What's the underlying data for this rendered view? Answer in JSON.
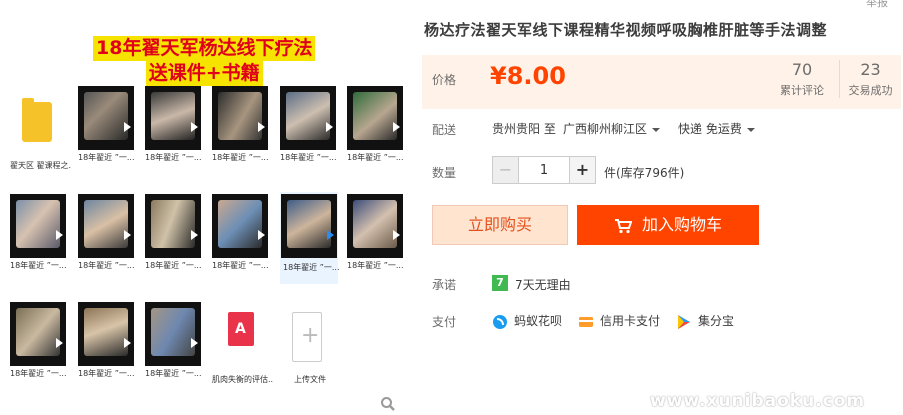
{
  "gallery": {
    "banner": {
      "line1": "18年翟天军杨达线下疗法",
      "line2": "送课件+书籍"
    },
    "items": [
      {
        "caption": "翟天区 翟课程之..."
      },
      {
        "caption": "18年翟近 ”一..."
      },
      {
        "caption": "18年翟近 ”一..."
      },
      {
        "caption": "18年翟近 ”一..."
      },
      {
        "caption": "18年翟近 ”一..."
      },
      {
        "caption": "18年翟近 ”一..."
      },
      {
        "caption": "18年翟近 ”一..."
      },
      {
        "caption": "18年翟近 ”一..."
      },
      {
        "caption": "18年翟近 ”一..."
      },
      {
        "caption": "18年翟近 ”一..."
      },
      {
        "caption": "18年翟近 ”一..."
      },
      {
        "caption": "18年翟近 ”一..."
      },
      {
        "caption": "18年翟近 ”一..."
      },
      {
        "caption": "18年翟近 ”一..."
      },
      {
        "caption": "18年翟近 ”一..."
      },
      {
        "caption": "肌肉失衡的评估..."
      },
      {
        "caption": "上传文件"
      }
    ]
  },
  "header": {
    "top_link": "举报"
  },
  "product": {
    "title": "杨达疗法翟天军线下课程精华视频呼吸胸椎肝脏等手法调整",
    "price_label": "价格",
    "price": "¥8.00",
    "reviews_count": "70",
    "reviews_label": "累计评论",
    "deals_count": "23",
    "deals_label": "交易成功"
  },
  "shipping": {
    "label": "配送",
    "from": "贵州贵阳 至",
    "to": "广西柳州柳江区",
    "method": "快递 免运费"
  },
  "quantity": {
    "label": "数量",
    "minus": "−",
    "value": "1",
    "plus": "+",
    "stock": "件(库存796件)"
  },
  "actions": {
    "buy_now": "立即购买",
    "add_to_cart": "加入购物车"
  },
  "promise": {
    "label": "承诺",
    "icon_text": "7",
    "text": "7天无理由"
  },
  "payment": {
    "label": "支付",
    "methods": [
      "蚂蚁花呗",
      "信用卡支付",
      "集分宝"
    ]
  },
  "watermark": "www.xunibaoku.com",
  "colors": {
    "accent": "#ff4400",
    "price": "#ff4400",
    "price_bg": "#fff2e8",
    "banner_bg": "#f7e300",
    "banner_text": "#e0001b"
  }
}
